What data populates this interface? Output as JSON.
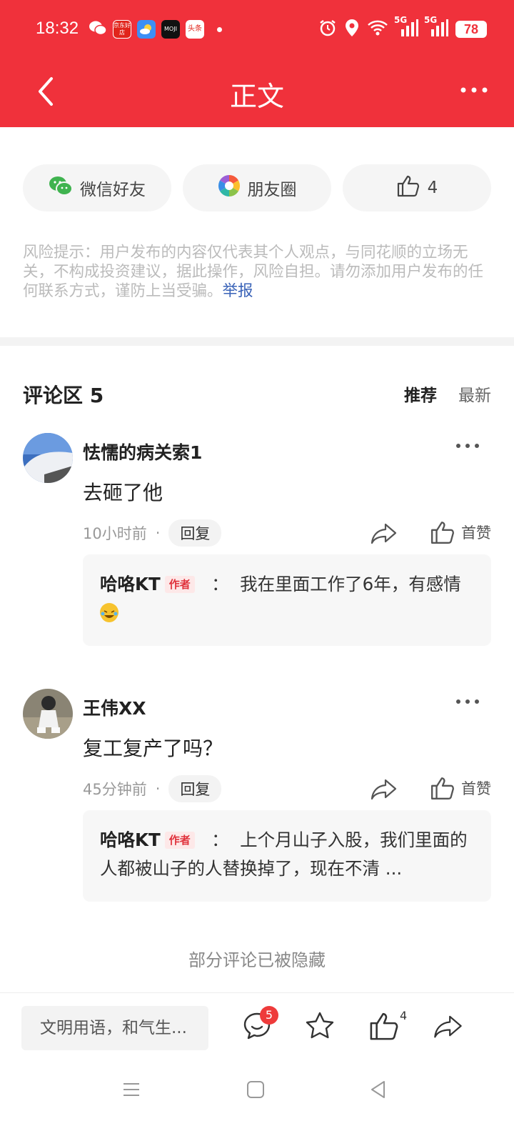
{
  "status": {
    "time": "18:32",
    "apps": [
      "京东好店",
      "MOJI",
      "头条"
    ],
    "signal1": "5G",
    "signal2": "5G",
    "battery": "78"
  },
  "header": {
    "title": "正文"
  },
  "share": {
    "wechat_label": "微信好友",
    "moments_label": "朋友圈",
    "like_count": "4"
  },
  "risk": {
    "text": "风险提示：用户发布的内容仅代表其个人观点，与同花顺的立场无关，不构成投资建议，据此操作，风险自担。请勿添加用户发布的任何联系方式，谨防上当受骗。",
    "report_link": "举报"
  },
  "comments_section": {
    "title": "评论区 5",
    "sort_recommend": "推荐",
    "sort_latest": "最新",
    "items": [
      {
        "user": "怯懦的病关索1",
        "text": "去砸了他",
        "time": "10小时前",
        "reply_label": "回复",
        "like_label": "首赞",
        "reply": {
          "name": "哈咯KT",
          "badge": "作者",
          "text": "我在里面工作了6年，有感情"
        }
      },
      {
        "user": "王伟XX",
        "text": "复工复产了吗？",
        "time": "45分钟前",
        "reply_label": "回复",
        "like_label": "首赞",
        "reply": {
          "name": "哈咯KT",
          "badge": "作者",
          "text": "上个月山子入股，我们里面的人都被山子的人替换掉了，现在不清 ..."
        }
      }
    ],
    "hidden_note": "部分评论已被隐藏"
  },
  "bottom": {
    "input_placeholder": "文明用语，和气生...",
    "comment_badge": "5",
    "like_count": "4"
  },
  "colors": {
    "brand_red": "#f0313b"
  }
}
